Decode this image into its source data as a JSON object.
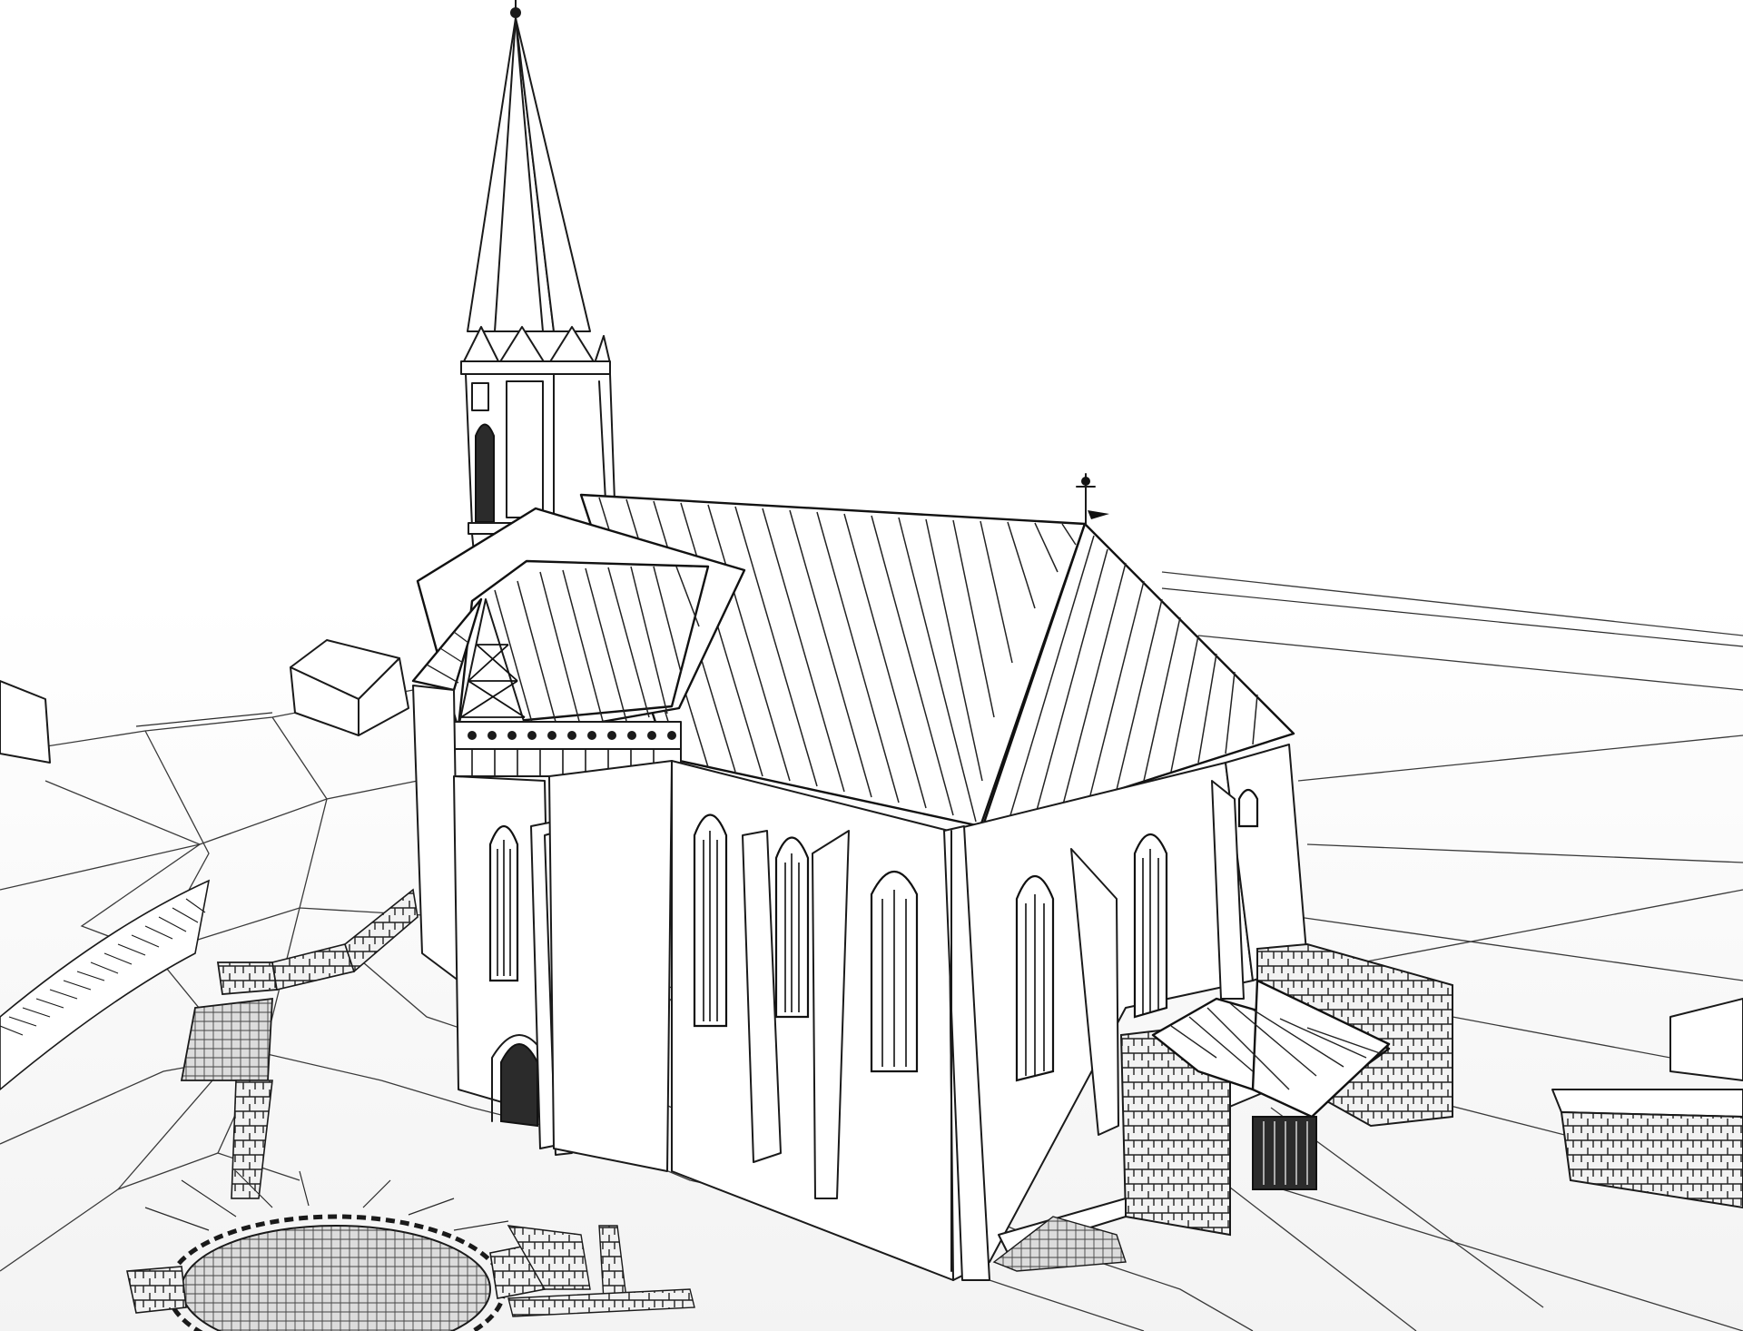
{
  "scene": {
    "subject": "gothic-church",
    "palette": {
      "background": "#ffffff",
      "ink": "#1a1a1a",
      "haze": "#f4f4f4"
    }
  }
}
